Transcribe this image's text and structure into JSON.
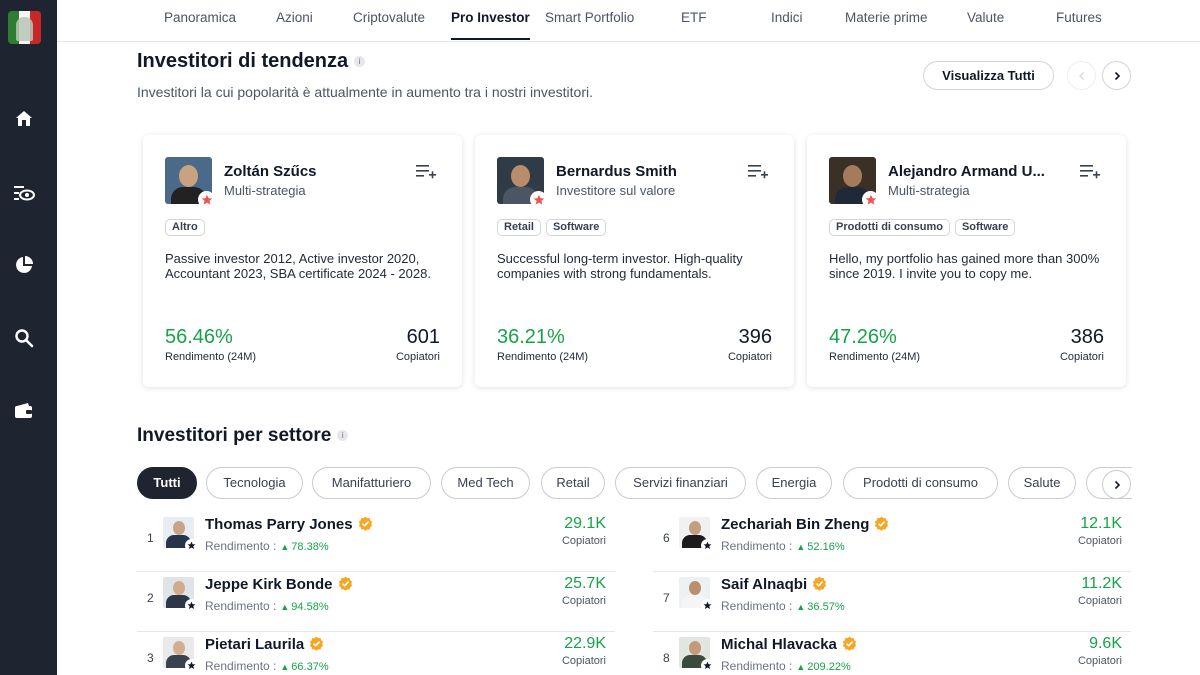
{
  "nav": {
    "tabs": [
      {
        "label": "Panoramica"
      },
      {
        "label": "Azioni"
      },
      {
        "label": "Criptovalute"
      },
      {
        "label": "Pro Investor"
      },
      {
        "label": "Smart Portfolio"
      },
      {
        "label": "ETF"
      },
      {
        "label": "Indici"
      },
      {
        "label": "Materie prime"
      },
      {
        "label": "Valute"
      },
      {
        "label": "Futures"
      }
    ],
    "active_tab": "Pro Investor"
  },
  "sidebar": {
    "icons": [
      "home-icon",
      "watchlist-icon",
      "portfolio-pie-icon",
      "search-icon",
      "wallet-icon"
    ]
  },
  "trending": {
    "title": "Investitori di tendenza",
    "info_glyph": "i",
    "subtitle": "Investitori la cui popolarità è attualmente in aumento tra i nostri investitori.",
    "view_all": "Visualizza Tutti",
    "cards": [
      {
        "name": "Zoltán Szűcs",
        "style": "Multi-strategia",
        "tags": [
          "Altro"
        ],
        "description": "Passive investor 2012, Active investor 2020, Accountant 2023, SBA certificate 2024 - 2028.",
        "return": "56.46%",
        "return_label": "Rendimento (24M)",
        "copiers": "601",
        "copiers_label": "Copiatori"
      },
      {
        "name": "Bernardus Smith",
        "style": "Investitore sul valore",
        "tags": [
          "Retail",
          "Software"
        ],
        "description": "Successful long-term investor. High-quality companies with strong fundamentals.",
        "return": "36.21%",
        "return_label": "Rendimento (24M)",
        "copiers": "396",
        "copiers_label": "Copiatori"
      },
      {
        "name": "Alejandro Armand U...",
        "style": "Multi-strategia",
        "tags": [
          "Prodotti di consumo",
          "Software"
        ],
        "description": "Hello, my portfolio has gained more than 300% since 2019. I invite you to copy me.",
        "return": "47.26%",
        "return_label": "Rendimento (24M)",
        "copiers": "386",
        "copiers_label": "Copiatori"
      }
    ]
  },
  "sectors": {
    "title": "Investitori per settore",
    "info_glyph": "i",
    "chips": [
      {
        "label": "Tutti"
      },
      {
        "label": "Tecnologia"
      },
      {
        "label": "Manifatturiero"
      },
      {
        "label": "Med Tech"
      },
      {
        "label": "Retail"
      },
      {
        "label": "Servizi finanziari"
      },
      {
        "label": "Energia"
      },
      {
        "label": "Prodotti di consumo"
      },
      {
        "label": "Salute"
      }
    ],
    "active_chip": "Tutti",
    "rows": [
      {
        "rank": "1",
        "name": "Thomas Parry Jones",
        "return_label": "Rendimento :",
        "return": "78.38%",
        "copiers": "29.1K",
        "copiers_label": "Copiatori"
      },
      {
        "rank": "2",
        "name": "Jeppe Kirk Bonde",
        "return_label": "Rendimento :",
        "return": "94.58%",
        "copiers": "25.7K",
        "copiers_label": "Copiatori"
      },
      {
        "rank": "3",
        "name": "Pietari Laurila",
        "return_label": "Rendimento :",
        "return": "66.37%",
        "copiers": "22.9K",
        "copiers_label": "Copiatori"
      },
      {
        "rank": "6",
        "name": "Zechariah Bin Zheng",
        "return_label": "Rendimento :",
        "return": "52.16%",
        "copiers": "12.1K",
        "copiers_label": "Copiatori"
      },
      {
        "rank": "7",
        "name": "Saif Alnaqbi",
        "return_label": "Rendimento :",
        "return": "36.57%",
        "copiers": "11.2K",
        "copiers_label": "Copiatori"
      },
      {
        "rank": "8",
        "name": "Michal Hlavacka",
        "return_label": "Rendimento :",
        "return": "209.22%",
        "copiers": "9.6K",
        "copiers_label": "Copiatori"
      }
    ]
  },
  "colors": {
    "sidebar": "#1f2530",
    "positive": "#16a34a",
    "star_badge": "#ef5350",
    "verified": "#f5a623",
    "chip_active": "#1f2530"
  }
}
